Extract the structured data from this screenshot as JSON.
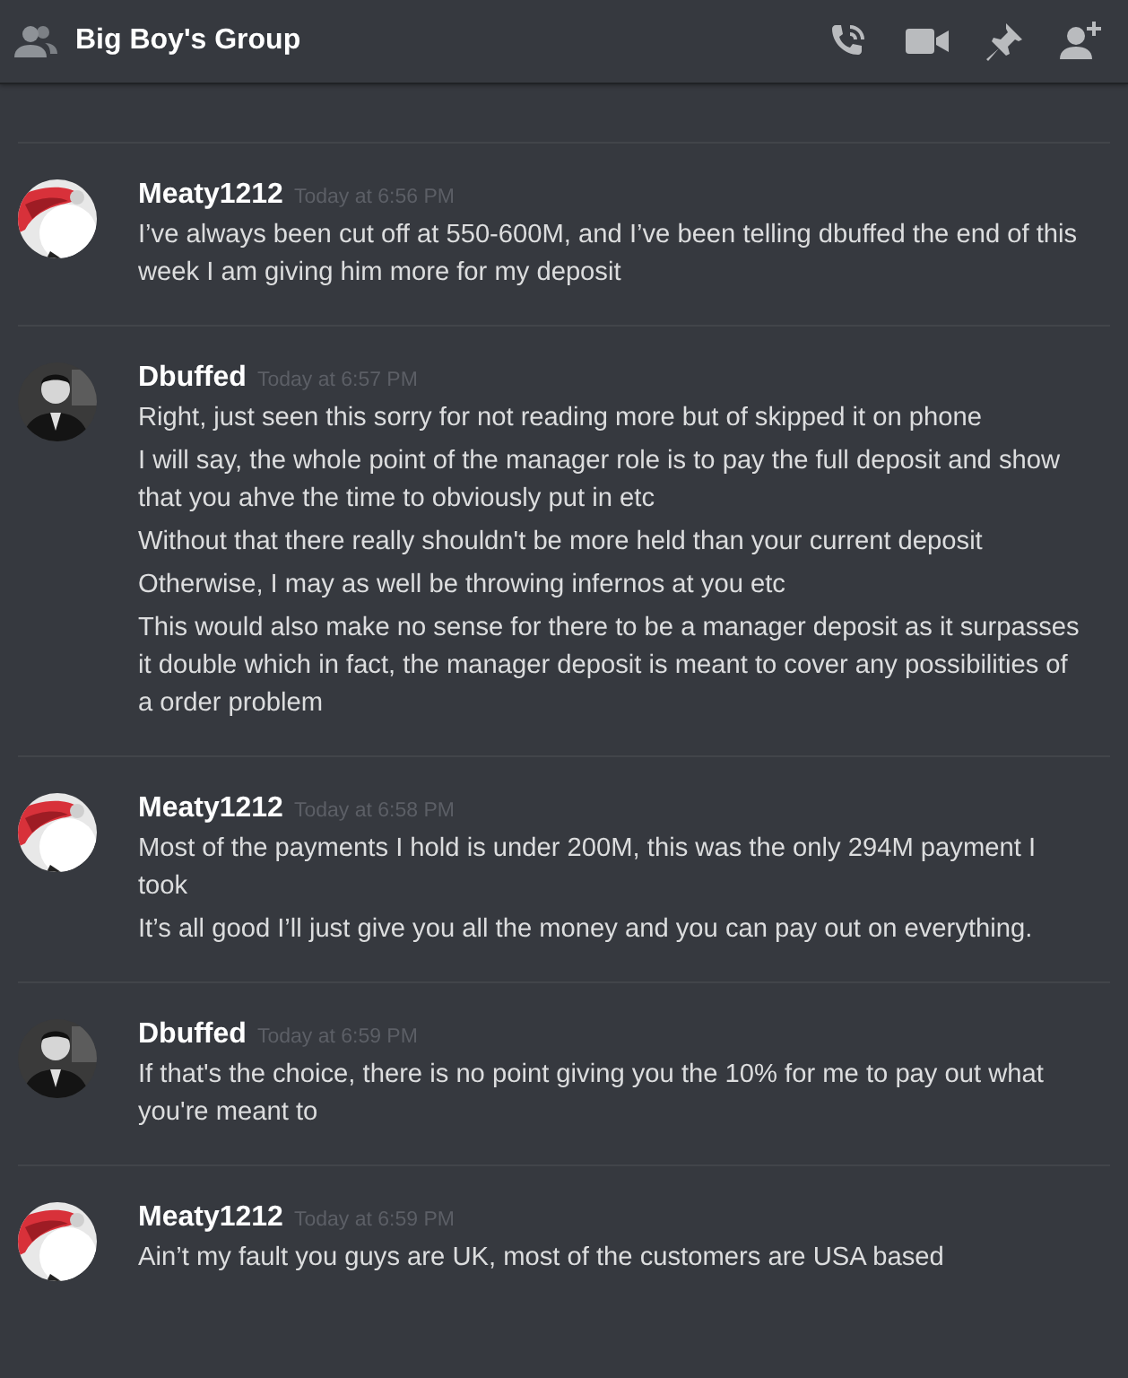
{
  "header": {
    "title": "Big Boy's Group"
  },
  "messages": [
    {
      "author": "Meaty1212",
      "kind": "blob",
      "time": "Today at 6:56 PM",
      "lines": [
        "I’ve always been cut off at 550-600M, and I’ve been telling dbuffed the end of this week I am giving him more for my deposit"
      ]
    },
    {
      "author": "Dbuffed",
      "kind": "figure",
      "time": "Today at 6:57 PM",
      "lines": [
        "Right, just seen this sorry for not reading more but of skipped it on phone",
        "I will say, the whole point of the manager role is to pay the full deposit and show that you ahve the time to obviously put in etc",
        "Without that there really shouldn't be more held than your current deposit",
        "Otherwise, I may as well be throwing infernos at you etc",
        "This would also make no sense for there to be a manager deposit as it surpasses it double which in fact, the manager deposit is meant to cover any possibilities of a order problem"
      ]
    },
    {
      "author": "Meaty1212",
      "kind": "blob",
      "time": "Today at 6:58 PM",
      "lines": [
        "Most of the payments I hold is under 200M, this was the only 294M payment I took",
        "It’s all good I’ll just give you all the money and you can pay out on everything."
      ]
    },
    {
      "author": "Dbuffed",
      "kind": "figure",
      "time": "Today at 6:59 PM",
      "lines": [
        "If that's the choice, there is no point giving you the 10% for me to pay out what you're meant to"
      ]
    },
    {
      "author": "Meaty1212",
      "kind": "blob",
      "time": "Today at 6:59 PM",
      "lines": [
        "Ain’t my fault you guys are UK, most of the customers are USA based"
      ]
    }
  ]
}
